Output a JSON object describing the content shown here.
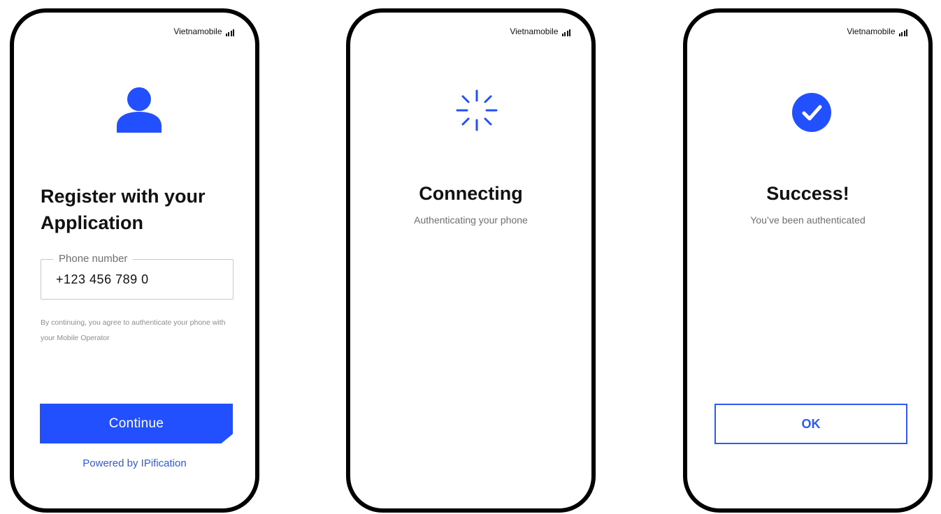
{
  "carrier": "Vietnamobile",
  "icons": {
    "signal": "signal-bars-icon",
    "user": "user-icon",
    "spinner": "loading-spinner-icon",
    "check": "check-circle-icon"
  },
  "colors": {
    "accent": "#2350ff",
    "link": "#2e59f5",
    "text": "#111111",
    "muted": "#6f6f6f",
    "frame": "#000000"
  },
  "screens": {
    "register": {
      "title": "Register with your Application",
      "phone_field": {
        "label": "Phone number",
        "value": "+123 456 789 0"
      },
      "consent": "By continuing, you agree to authenticate your phone with your Mobile Operator",
      "continue_label": "Continue",
      "powered_by": "Powered by IPification"
    },
    "connecting": {
      "title": "Connecting",
      "subtitle": "Authenticating your phone"
    },
    "success": {
      "title": "Success!",
      "subtitle": "You’ve been authenticated",
      "ok_label": "OK"
    }
  }
}
